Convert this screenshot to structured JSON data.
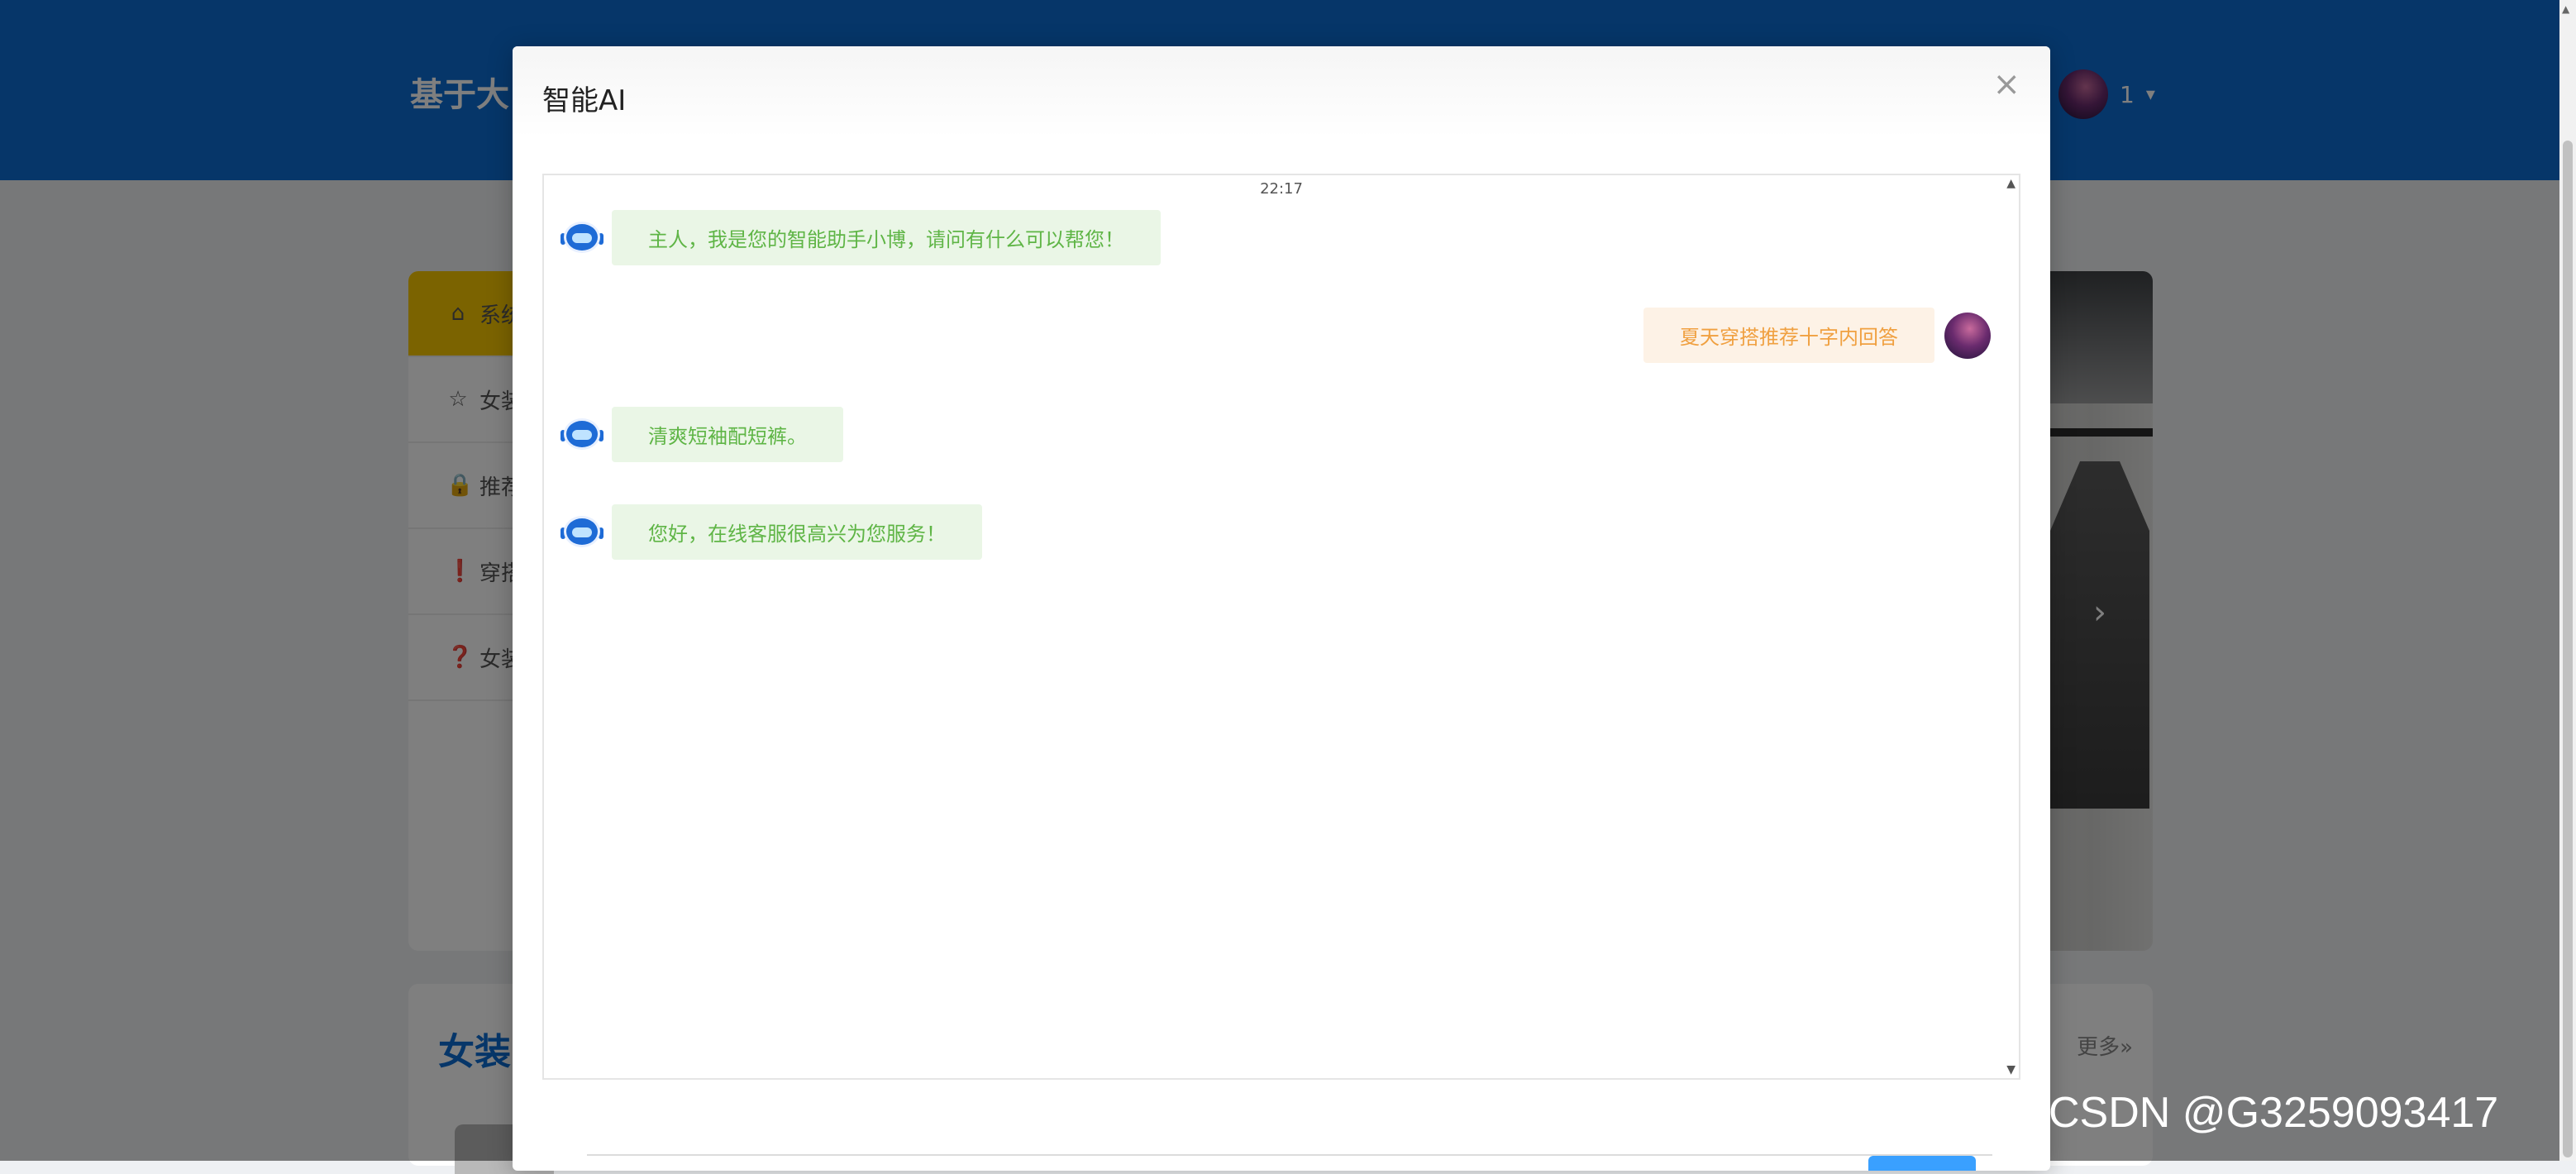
{
  "header": {
    "site_title": "基于大",
    "user_name": "1",
    "caret": "▾"
  },
  "sidebar": {
    "items": [
      {
        "label": "系统",
        "icon": "⌂"
      },
      {
        "label": "女装",
        "icon": "☆"
      },
      {
        "label": "推荐",
        "icon": "🔒"
      },
      {
        "label": "穿搭",
        "icon": "❗"
      },
      {
        "label": "女装",
        "icon": "❓"
      }
    ]
  },
  "banner": {
    "arrow": "›"
  },
  "section": {
    "title": "女装",
    "more": "更多»"
  },
  "modal": {
    "title": "智能AI",
    "close": "×",
    "chat": {
      "time": "22:17",
      "messages": [
        {
          "role": "bot",
          "text": "主人，我是您的智能助手小博，请问有什么可以帮您！"
        },
        {
          "role": "user",
          "text": "夏天穿搭推荐十字内回答"
        },
        {
          "role": "bot",
          "text": "清爽短袖配短裤。"
        },
        {
          "role": "bot",
          "text": "您好，在线客服很高兴为您服务！"
        }
      ]
    }
  },
  "watermark": "CSDN @G3259093417"
}
